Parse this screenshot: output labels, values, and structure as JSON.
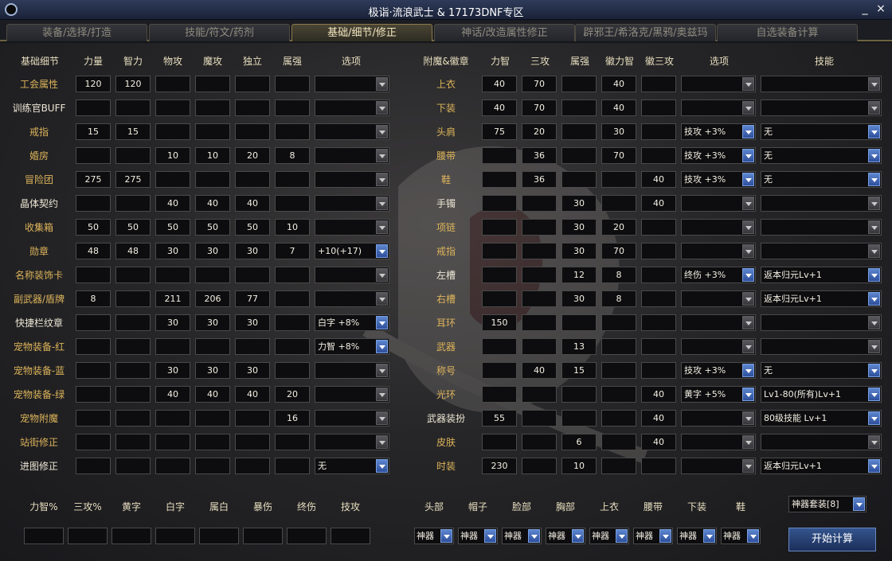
{
  "window": {
    "title": "极诣·流浪武士 & 17173DNF专区",
    "minimize": "_",
    "close": "×"
  },
  "tabs": [
    {
      "label": "装备/选择/打造"
    },
    {
      "label": "技能/符文/药剂"
    },
    {
      "label": "基础/细节/修正",
      "active": true
    },
    {
      "label": "神话/改造属性修正"
    },
    {
      "label": "辟邪王/希洛克/黑鸦/奥兹玛"
    },
    {
      "label": "自选装备计算"
    }
  ],
  "left_headers": [
    "基础细节",
    "力量",
    "智力",
    "物攻",
    "魔攻",
    "独立",
    "属强",
    "选项"
  ],
  "left_rows": [
    {
      "label": "工会属性",
      "color": "gold",
      "values": [
        "120",
        "120",
        "",
        "",
        "",
        ""
      ],
      "option": ""
    },
    {
      "label": "训练官BUFF",
      "color": "white",
      "values": [
        "",
        "",
        "",
        "",
        "",
        ""
      ],
      "option": ""
    },
    {
      "label": "戒指",
      "color": "gold",
      "values": [
        "15",
        "15",
        "",
        "",
        "",
        ""
      ],
      "option": ""
    },
    {
      "label": "婚房",
      "color": "gold",
      "values": [
        "",
        "",
        "10",
        "10",
        "20",
        "8"
      ],
      "option": ""
    },
    {
      "label": "冒险团",
      "color": "gold",
      "values": [
        "275",
        "275",
        "",
        "",
        "",
        ""
      ],
      "option": ""
    },
    {
      "label": "晶体契约",
      "color": "white",
      "values": [
        "",
        "",
        "40",
        "40",
        "40",
        ""
      ],
      "option": ""
    },
    {
      "label": "收集箱",
      "color": "gold",
      "values": [
        "50",
        "50",
        "50",
        "50",
        "50",
        "10"
      ],
      "option": ""
    },
    {
      "label": "勋章",
      "color": "gold",
      "values": [
        "48",
        "48",
        "30",
        "30",
        "30",
        "7"
      ],
      "option": "+10(+17)"
    },
    {
      "label": "名称装饰卡",
      "color": "gold",
      "values": [
        "",
        "",
        "",
        "",
        "",
        ""
      ],
      "option": ""
    },
    {
      "label": "副武器/盾牌",
      "color": "gold",
      "values": [
        "8",
        "",
        "211",
        "206",
        "77",
        ""
      ],
      "option": ""
    },
    {
      "label": "快捷栏纹章",
      "color": "white",
      "values": [
        "",
        "",
        "30",
        "30",
        "30",
        ""
      ],
      "option": "白字 +8%"
    },
    {
      "label": "宠物装备-红",
      "color": "gold",
      "values": [
        "",
        "",
        "",
        "",
        "",
        ""
      ],
      "option": "力智 +8%"
    },
    {
      "label": "宠物装备-蓝",
      "color": "gold",
      "values": [
        "",
        "",
        "30",
        "30",
        "30",
        ""
      ],
      "option": ""
    },
    {
      "label": "宠物装备-绿",
      "color": "gold",
      "values": [
        "",
        "",
        "40",
        "40",
        "40",
        "20"
      ],
      "option": ""
    },
    {
      "label": "宠物附魔",
      "color": "gold",
      "values": [
        "",
        "",
        "",
        "",
        "",
        "16"
      ],
      "option": ""
    },
    {
      "label": "站街修正",
      "color": "gold",
      "values": [
        "",
        "",
        "",
        "",
        "",
        ""
      ],
      "option": ""
    },
    {
      "label": "进图修正",
      "color": "white",
      "values": [
        "",
        "",
        "",
        "",
        "",
        ""
      ],
      "option": "无"
    }
  ],
  "right_headers": [
    "附魔&徽章",
    "力智",
    "三攻",
    "属强",
    "徽力智",
    "徽三攻",
    "选项",
    "技能"
  ],
  "right_rows": [
    {
      "label": "上衣",
      "color": "gold",
      "values": [
        "40",
        "70",
        "",
        "40",
        ""
      ],
      "option": "",
      "skill": ""
    },
    {
      "label": "下装",
      "color": "gold",
      "values": [
        "40",
        "70",
        "",
        "40",
        ""
      ],
      "option": "",
      "skill": ""
    },
    {
      "label": "头肩",
      "color": "gold",
      "values": [
        "75",
        "20",
        "",
        "30",
        ""
      ],
      "option": "技攻 +3%",
      "skill": "无"
    },
    {
      "label": "腰带",
      "color": "gold",
      "values": [
        "",
        "36",
        "",
        "70",
        ""
      ],
      "option": "技攻 +3%",
      "skill": "无"
    },
    {
      "label": "鞋",
      "color": "gold",
      "values": [
        "",
        "36",
        "",
        "",
        "40"
      ],
      "option": "技攻 +3%",
      "skill": "无"
    },
    {
      "label": "手镯",
      "color": "white",
      "values": [
        "",
        "",
        "30",
        "",
        "40"
      ],
      "option": "",
      "skill": ""
    },
    {
      "label": "项链",
      "color": "gold",
      "values": [
        "",
        "",
        "30",
        "20",
        ""
      ],
      "option": "",
      "skill": ""
    },
    {
      "label": "戒指",
      "color": "gold",
      "values": [
        "",
        "",
        "30",
        "70",
        ""
      ],
      "option": "",
      "skill": ""
    },
    {
      "label": "左槽",
      "color": "white",
      "values": [
        "",
        "",
        "12",
        "8",
        ""
      ],
      "option": "终伤 +3%",
      "skill": "返本归元Lv+1"
    },
    {
      "label": "右槽",
      "color": "gold",
      "values": [
        "",
        "",
        "30",
        "8",
        ""
      ],
      "option": "",
      "skill": "返本归元Lv+1"
    },
    {
      "label": "耳环",
      "color": "gold",
      "values": [
        "150",
        "",
        "",
        "",
        ""
      ],
      "option": "",
      "skill": ""
    },
    {
      "label": "武器",
      "color": "gold",
      "values": [
        "",
        "",
        "13",
        "",
        ""
      ],
      "option": "",
      "skill": ""
    },
    {
      "label": "称号",
      "color": "gold",
      "values": [
        "",
        "40",
        "15",
        "",
        ""
      ],
      "option": "技攻 +3%",
      "skill": "无"
    },
    {
      "label": "光环",
      "color": "gold",
      "values": [
        "",
        "",
        "",
        "",
        "40"
      ],
      "option": "黄字 +5%",
      "skill": "Lv1-80(所有)Lv+1"
    },
    {
      "label": "武器装扮",
      "color": "white",
      "values": [
        "55",
        "",
        "",
        "",
        "40"
      ],
      "option": "",
      "skill": "80级技能 Lv+1"
    },
    {
      "label": "皮肤",
      "color": "gold",
      "values": [
        "",
        "",
        "6",
        "",
        "40"
      ],
      "option": "",
      "skill": ""
    },
    {
      "label": "时装",
      "color": "gold",
      "values": [
        "230",
        "",
        "10",
        "",
        ""
      ],
      "option": "",
      "skill": "返本归元Lv+1"
    }
  ],
  "bottom_left_labels": [
    "力智%",
    "三攻%",
    "黄字",
    "白字",
    "属白",
    "暴伤",
    "终伤",
    "技攻"
  ],
  "bottom_right_labels": [
    "头部",
    "帽子",
    "脸部",
    "胸部",
    "上衣",
    "腰带",
    "下装",
    "鞋"
  ],
  "bottom_select_value": "神器",
  "set_select": "神器套装[8]",
  "calc_button": "开始计算"
}
